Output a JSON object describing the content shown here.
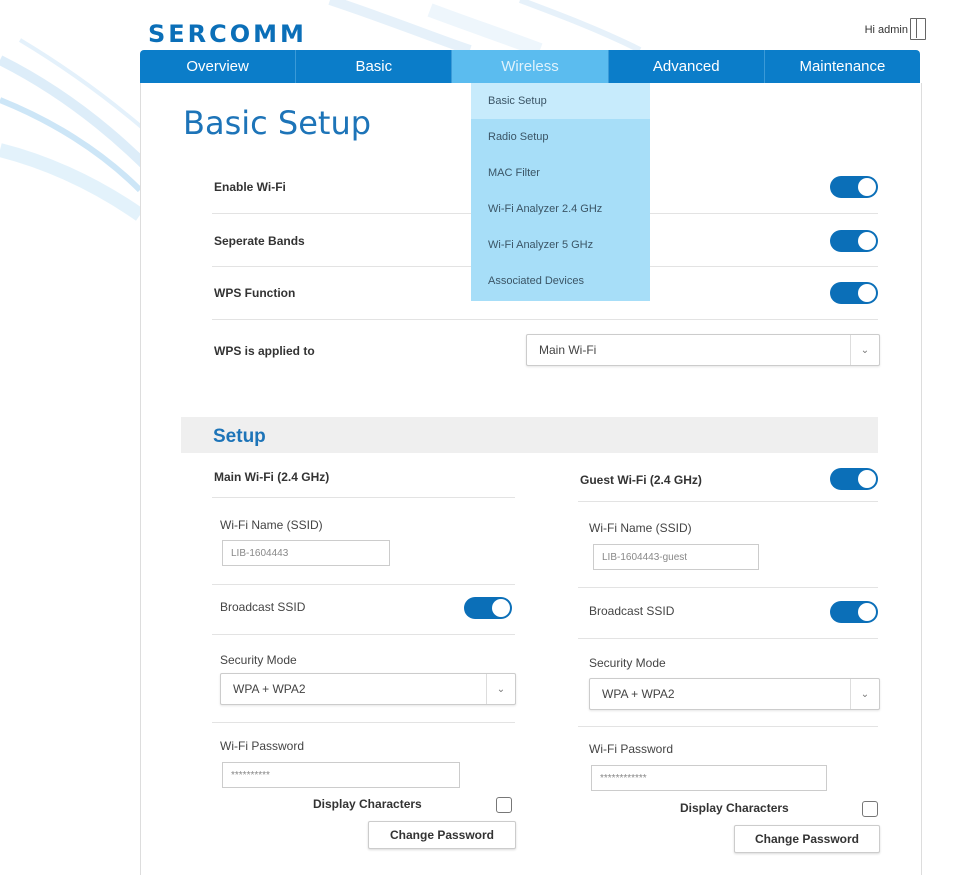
{
  "brand": {
    "logo_text": "SERCOMM",
    "greeting": "Hi admin"
  },
  "nav": {
    "tabs": [
      "Overview",
      "Basic",
      "Wireless",
      "Advanced",
      "Maintenance"
    ],
    "active": "Wireless"
  },
  "dropdown": {
    "items": [
      "Basic Setup",
      "Radio Setup",
      "MAC Filter",
      "Wi-Fi Analyzer 2.4 GHz",
      "Wi-Fi Analyzer 5 GHz",
      "Associated Devices"
    ],
    "active": "Basic Setup"
  },
  "page": {
    "title": "Basic Setup"
  },
  "settings": {
    "enable_wifi": {
      "label": "Enable Wi-Fi",
      "on": true
    },
    "separate_bands": {
      "label": "Seperate Bands",
      "on": true
    },
    "wps_function": {
      "label": "WPS Function",
      "on": true
    },
    "wps_applied": {
      "label": "WPS is applied to",
      "value": "Main Wi-Fi"
    }
  },
  "setup": {
    "title": "Setup",
    "main": {
      "header": "Main Wi-Fi (2.4 GHz)",
      "ssid_label": "Wi-Fi Name (SSID)",
      "ssid_value": "LIB-1604443",
      "broadcast_label": "Broadcast SSID",
      "broadcast_on": true,
      "security_label": "Security Mode",
      "security_value": "WPA + WPA2",
      "password_label": "Wi-Fi Password",
      "password_value": "**********",
      "display_chars_label": "Display Characters",
      "change_password_label": "Change Password"
    },
    "guest": {
      "header": "Guest Wi-Fi (2.4 GHz)",
      "enabled": true,
      "ssid_label": "Wi-Fi Name (SSID)",
      "ssid_value": "LIB-1604443-guest",
      "broadcast_label": "Broadcast SSID",
      "broadcast_on": true,
      "security_label": "Security Mode",
      "security_value": "WPA + WPA2",
      "password_label": "Wi-Fi Password",
      "password_value": "************",
      "display_chars_label": "Display Characters",
      "change_password_label": "Change Password"
    }
  },
  "colors": {
    "accent": "#0b6fb8",
    "nav": "#0b7dc9",
    "nav_active": "#5bbcef",
    "dropdown": "#a7def8"
  }
}
